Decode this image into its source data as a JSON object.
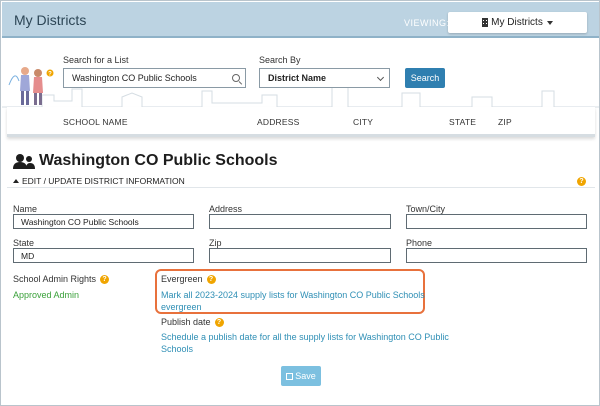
{
  "header": {
    "title": "My Districts",
    "viewing_label": "VIEWING:",
    "view_dropdown": "My Districts"
  },
  "search": {
    "list_label": "Search for a List",
    "list_value": "Washington CO Public Schools",
    "by_label": "Search By",
    "by_value": "District Name",
    "button": "Search"
  },
  "table": {
    "columns": [
      "SCHOOL NAME",
      "ADDRESS",
      "CITY",
      "STATE",
      "ZIP"
    ]
  },
  "district": {
    "title": "Washington CO Public Schools",
    "edit_link": "EDIT / UPDATE DISTRICT INFORMATION"
  },
  "fields": {
    "name": {
      "label": "Name",
      "value": "Washington CO Public Schools"
    },
    "address": {
      "label": "Address",
      "value": ""
    },
    "town": {
      "label": "Town/City",
      "value": ""
    },
    "state": {
      "label": "State",
      "value": "MD"
    },
    "zip": {
      "label": "Zip",
      "value": ""
    },
    "phone": {
      "label": "Phone",
      "value": ""
    }
  },
  "admin": {
    "label": "School Admin Rights",
    "value": "Approved Admin"
  },
  "evergreen": {
    "label": "Evergreen",
    "link_line1": "Mark all 2023-2024 supply lists for Washington CO Public Schools",
    "link_line2": "evergreen"
  },
  "publish": {
    "label": "Publish date",
    "link_line1": "Schedule a publish date for all the supply lists for Washington CO Public",
    "link_line2": "Schools"
  },
  "save_button": "Save",
  "help_glyph": "?",
  "colors": {
    "header_bg": "#bcd3e2",
    "primary_button": "#2f7fb0",
    "save_button": "#7cc0e0",
    "link": "#2f8fb5",
    "approved": "#3aa13a",
    "help_badge": "#f0a500",
    "highlight": "#e8713c"
  }
}
